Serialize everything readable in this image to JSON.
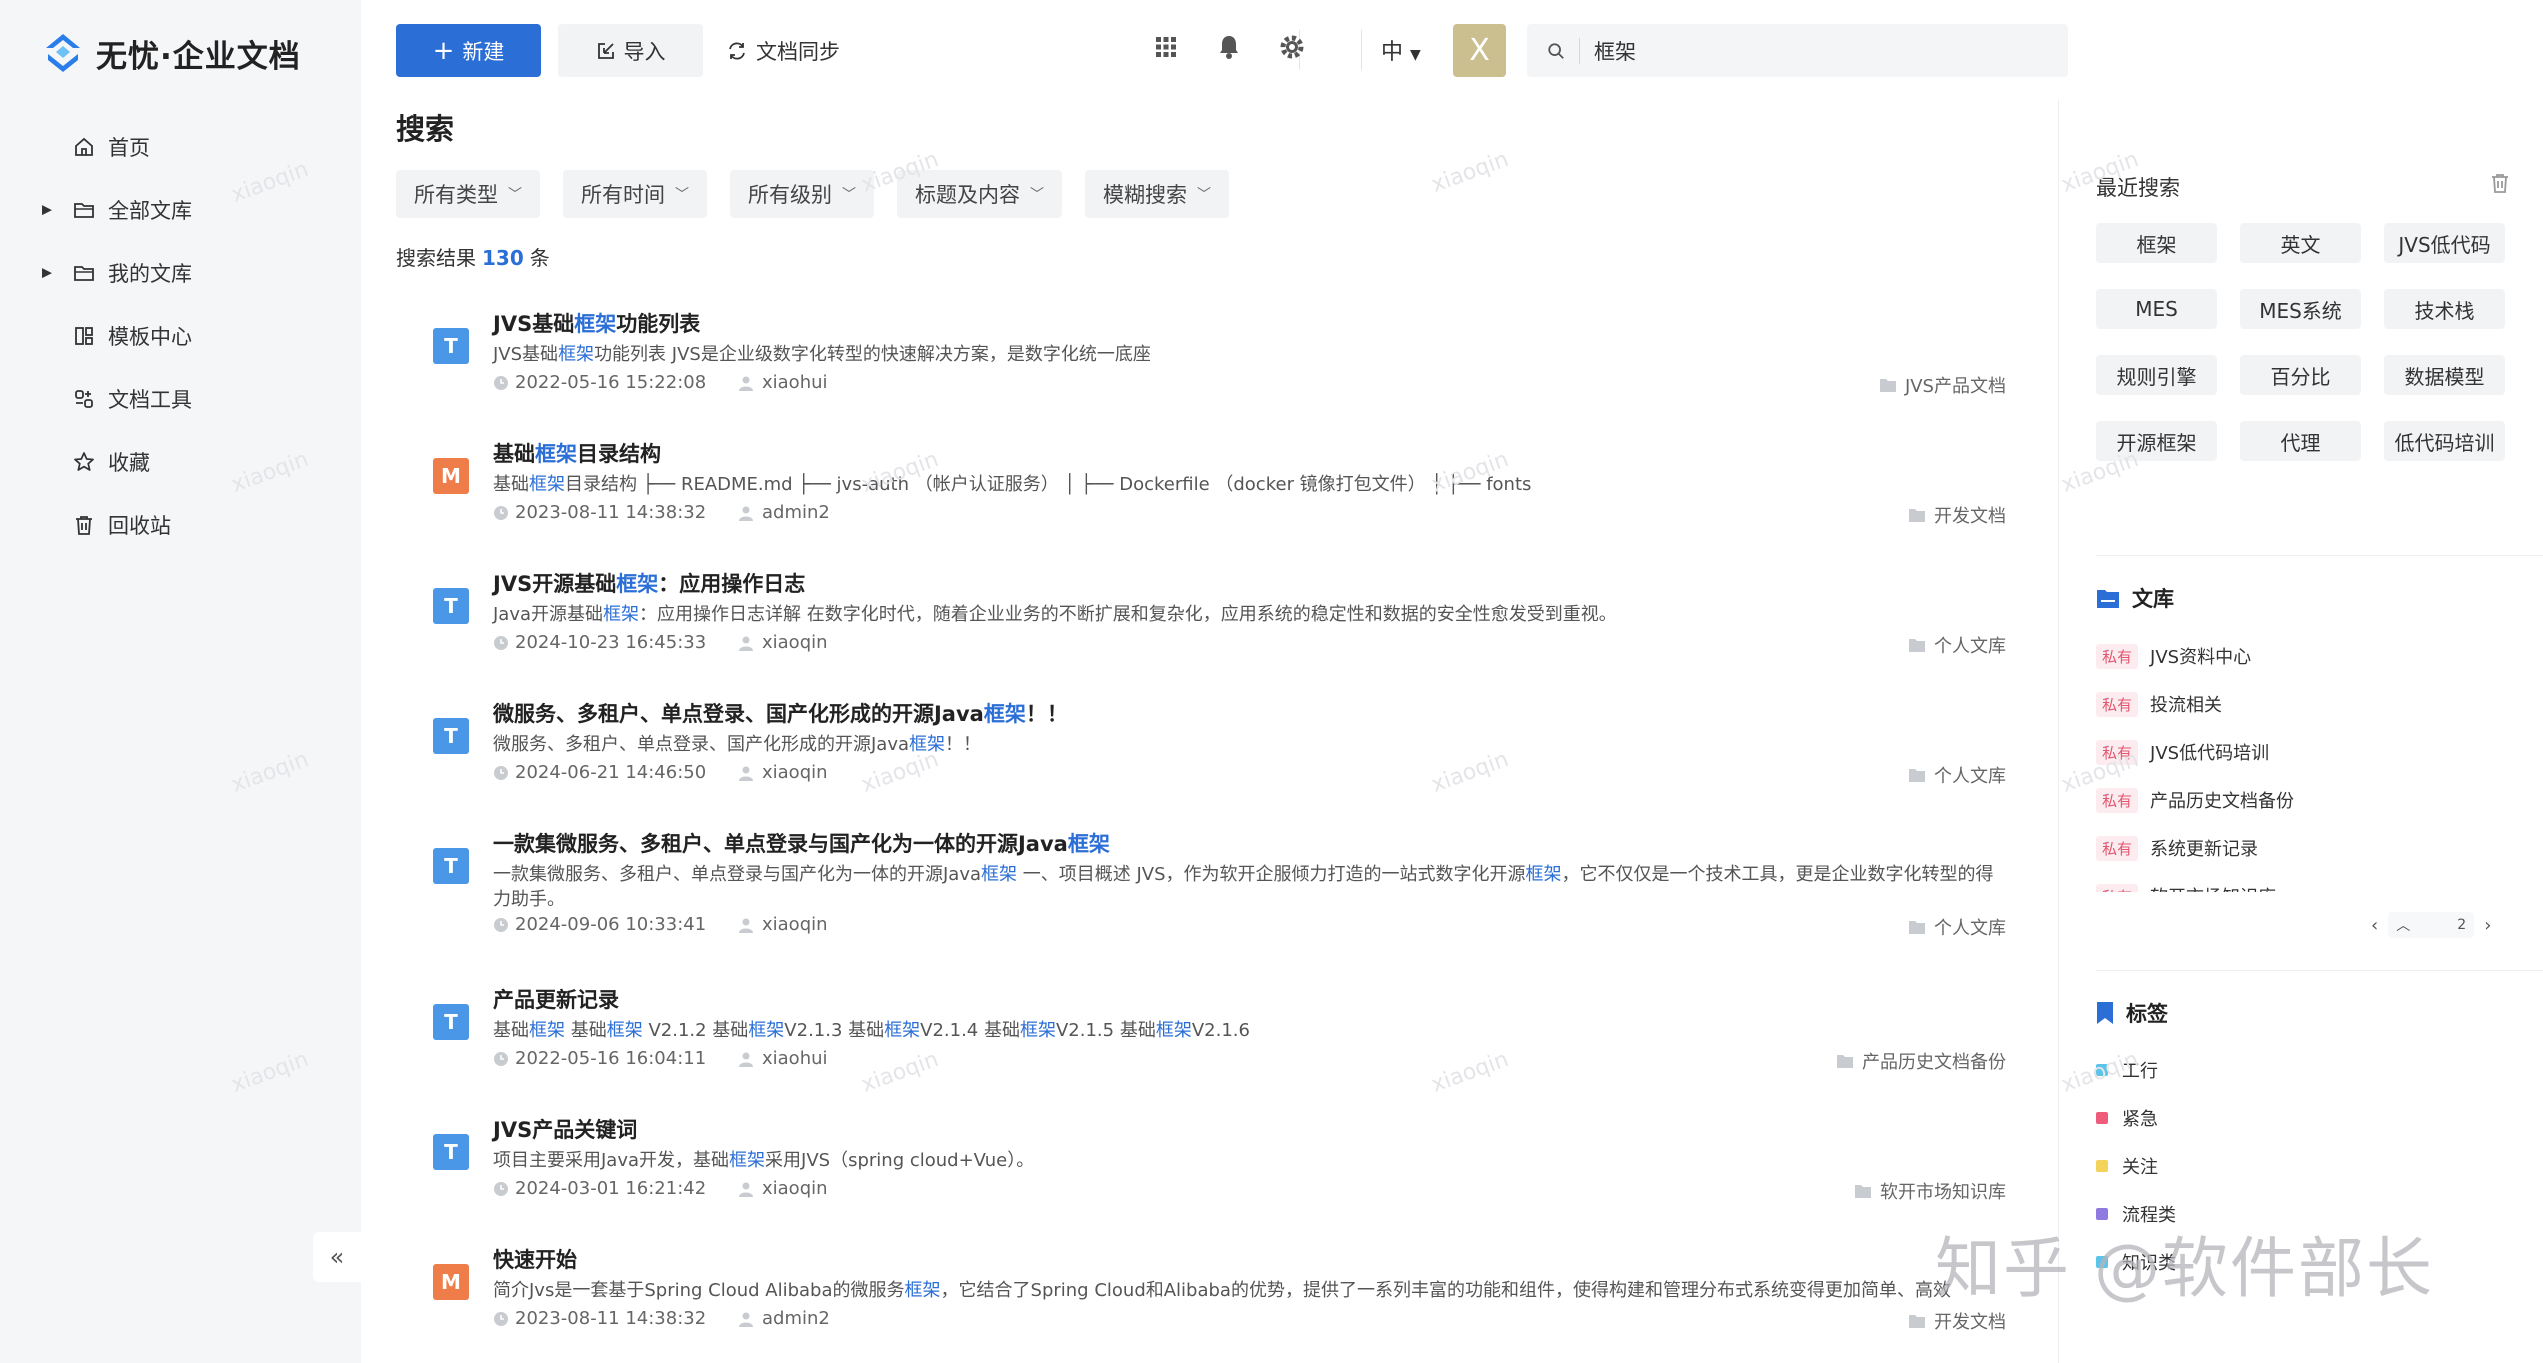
{
  "app": {
    "logo_text": "无忧·企业文档"
  },
  "sidebar": {
    "items": [
      {
        "label": "首页",
        "icon": "home-icon",
        "expandable": false
      },
      {
        "label": "全部文库",
        "icon": "folder-icon",
        "expandable": true
      },
      {
        "label": "我的文库",
        "icon": "folder-icon",
        "expandable": true
      },
      {
        "label": "模板中心",
        "icon": "template-icon",
        "expandable": false
      },
      {
        "label": "文档工具",
        "icon": "tools-icon",
        "expandable": false
      },
      {
        "label": "收藏",
        "icon": "star-icon",
        "expandable": false
      },
      {
        "label": "回收站",
        "icon": "trash-icon",
        "expandable": false
      }
    ],
    "collapse_label": "«"
  },
  "toolbar": {
    "new_label": "新建",
    "import_label": "导入",
    "sync_label": "文档同步",
    "search_value": "框架",
    "lang_label": "中",
    "avatar_letter": "X"
  },
  "page": {
    "title": "搜索",
    "filters": [
      "所有类型",
      "所有时间",
      "所有级别",
      "标题及内容",
      "模糊搜索"
    ],
    "count_prefix": "搜索结果",
    "count": "130",
    "count_suffix": "条"
  },
  "results": [
    {
      "icon_type": "T",
      "icon_color": "#4a97e8",
      "title": [
        [
          "JVS基础",
          false
        ],
        [
          "框架",
          true
        ],
        [
          "功能列表",
          false
        ]
      ],
      "snippet": [
        [
          "JVS基础",
          false
        ],
        [
          "框架",
          true
        ],
        [
          "功能列表 JVS是企业级数字化转型的快速解决方案，是数字化统一底座",
          false
        ]
      ],
      "time": "2022-05-16 15:22:08",
      "user": "xiaohui",
      "library": "JVS产品文档"
    },
    {
      "icon_type": "M",
      "icon_color": "#ee7d4a",
      "title": [
        [
          "基础",
          false
        ],
        [
          "框架",
          true
        ],
        [
          "目录结构",
          false
        ]
      ],
      "snippet": [
        [
          "基础",
          false
        ],
        [
          "框架",
          true
        ],
        [
          "目录结构 ├── README.md ├── jvs-auth （帐户认证服务） │ ├── Dockerfile （docker 镜像打包文件） │ ├── fonts",
          false
        ]
      ],
      "time": "2023-08-11 14:38:32",
      "user": "admin2",
      "library": "开发文档"
    },
    {
      "icon_type": "T",
      "icon_color": "#4a97e8",
      "title": [
        [
          "JVS开源基础",
          false
        ],
        [
          "框架",
          true
        ],
        [
          "：应用操作日志",
          false
        ]
      ],
      "snippet": [
        [
          "Java开源基础",
          false
        ],
        [
          "框架",
          true
        ],
        [
          "：应用操作日志详解 在数字化时代，随着企业业务的不断扩展和复杂化，应用系统的稳定性和数据的安全性愈发受到重视。",
          false
        ]
      ],
      "time": "2024-10-23 16:45:33",
      "user": "xiaoqin",
      "library": "个人文库"
    },
    {
      "icon_type": "T",
      "icon_color": "#4a97e8",
      "title": [
        [
          "微服务、多租户、单点登录、国产化形成的开源Java",
          false
        ],
        [
          "框架",
          true
        ],
        [
          "！！",
          false
        ]
      ],
      "snippet": [
        [
          "微服务、多租户、单点登录、国产化形成的开源Java",
          false
        ],
        [
          "框架",
          true
        ],
        [
          "！！",
          false
        ]
      ],
      "time": "2024-06-21 14:46:50",
      "user": "xiaoqin",
      "library": "个人文库"
    },
    {
      "icon_type": "T",
      "icon_color": "#4a97e8",
      "title": [
        [
          "一款集微服务、多租户、单点登录与国产化为一体的开源Java",
          false
        ],
        [
          "框架",
          true
        ]
      ],
      "snippet": [
        [
          "一款集微服务、多租户、单点登录与国产化为一体的开源Java",
          false
        ],
        [
          "框架",
          true
        ],
        [
          " 一、项目概述 JVS，作为软开企服倾力打造的一站式数字化开源",
          false
        ],
        [
          "框架",
          true
        ],
        [
          "，它不仅仅是一个技术工具，更是企业数字化转型的得力助手。",
          false
        ]
      ],
      "time": "2024-09-06 10:33:41",
      "user": "xiaoqin",
      "library": "个人文库"
    },
    {
      "icon_type": "T",
      "icon_color": "#4a97e8",
      "title": [
        [
          "产品更新记录",
          false
        ]
      ],
      "snippet": [
        [
          "基础",
          false
        ],
        [
          "框架",
          true
        ],
        [
          " 基础",
          false
        ],
        [
          "框架",
          true
        ],
        [
          " V2.1.2 基础",
          false
        ],
        [
          "框架",
          true
        ],
        [
          "V2.1.3 基础",
          false
        ],
        [
          "框架",
          true
        ],
        [
          "V2.1.4 基础",
          false
        ],
        [
          "框架",
          true
        ],
        [
          "V2.1.5 基础",
          false
        ],
        [
          "框架",
          true
        ],
        [
          "V2.1.6",
          false
        ]
      ],
      "time": "2022-05-16 16:04:11",
      "user": "xiaohui",
      "library": "产品历史文档备份"
    },
    {
      "icon_type": "T",
      "icon_color": "#4a97e8",
      "title": [
        [
          "JVS产品关键词",
          false
        ]
      ],
      "snippet": [
        [
          "项目主要采用Java开发，基础",
          false
        ],
        [
          "框架",
          true
        ],
        [
          "采用JVS（spring cloud+Vue）。",
          false
        ]
      ],
      "time": "2024-03-01 16:21:42",
      "user": "xiaoqin",
      "library": "软开市场知识库"
    },
    {
      "icon_type": "M",
      "icon_color": "#ee7d4a",
      "title": [
        [
          "快速开始",
          false
        ]
      ],
      "snippet": [
        [
          "简介Jvs是一套基于Spring Cloud Alibaba的微服务",
          false
        ],
        [
          "框架",
          true
        ],
        [
          "，它结合了Spring Cloud和Alibaba的优势，提供了一系列丰富的功能和组件，使得构建和管理分布式系统变得更加简单、高效",
          false
        ]
      ],
      "time": "2023-08-11 14:38:32",
      "user": "admin2",
      "library": "开发文档"
    }
  ],
  "recent": {
    "title": "最近搜索",
    "chips": [
      "框架",
      "英文",
      "JVS低代码",
      "MES",
      "MES系统",
      "技术栈",
      "规则引擎",
      "百分比",
      "数据模型",
      "开源框架",
      "代理",
      "低代码培训"
    ]
  },
  "libraries": {
    "title": "文库",
    "badge": "私有",
    "items": [
      "JVS资料中心",
      "投流相关",
      "JVS低代码培训",
      "产品历史文档备份",
      "系统更新记录",
      "软开市场知识库"
    ],
    "pager_text": "2"
  },
  "tags": {
    "title": "标签",
    "items": [
      {
        "label": "工行",
        "color": "#5bc4e8"
      },
      {
        "label": "紧急",
        "color": "#ee5c7a"
      },
      {
        "label": "关注",
        "color": "#f3d35c"
      },
      {
        "label": "流程类",
        "color": "#8f7be0"
      },
      {
        "label": "知识类",
        "color": "#5bc4e8"
      }
    ]
  },
  "watermark": {
    "text": "xiaoqin",
    "brand": "知乎 @软件部长"
  }
}
